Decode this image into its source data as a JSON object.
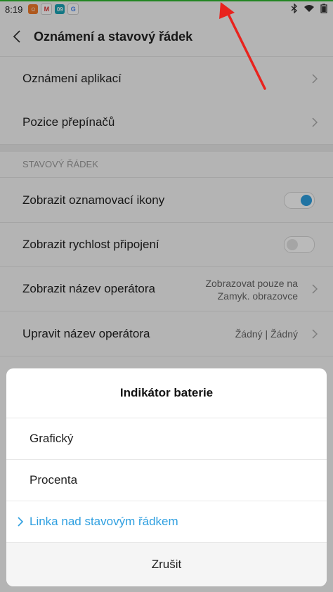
{
  "status_bar": {
    "time": "8:19",
    "app_icons": [
      {
        "name": "notification-app-icon",
        "color": "#f07b2a",
        "glyph": "☺"
      },
      {
        "name": "gmail-icon",
        "color": "#ffffff",
        "glyph": "M"
      },
      {
        "name": "calendar-app-icon",
        "color": "#1aa3b5",
        "glyph": "09"
      },
      {
        "name": "google-icon",
        "color": "#ffffff",
        "glyph": "G"
      }
    ],
    "system_icons": [
      "bluetooth-icon",
      "wifi-icon",
      "battery-icon"
    ]
  },
  "header": {
    "title": "Oznámení a stavový řádek"
  },
  "items": {
    "app_notifications": "Oznámení aplikací",
    "toggle_position": "Pozice přepínačů"
  },
  "section": {
    "title": "STAVOVÝ ŘÁDEK",
    "show_notification_icons": {
      "label": "Zobrazit oznamovací ikony",
      "enabled": true
    },
    "show_connection_speed": {
      "label": "Zobrazit rychlost připojení",
      "enabled": false
    },
    "show_operator_name": {
      "label": "Zobrazit název operátora",
      "value_line1": "Zobrazovat pouze na",
      "value_line2": "Zamyk. obrazovce"
    },
    "edit_operator_name": {
      "label": "Upravit název operátora",
      "value": "Žádný | Žádný"
    }
  },
  "dialog": {
    "title": "Indikátor baterie",
    "options": [
      {
        "label": "Grafický",
        "selected": false
      },
      {
        "label": "Procenta",
        "selected": false
      },
      {
        "label": "Linka nad stavovým řádkem",
        "selected": true
      }
    ],
    "cancel_label": "Zrušit"
  },
  "colors": {
    "accent": "#2e9fe0",
    "battery_line": "#2fb82f",
    "annotation_arrow": "#e8231e"
  }
}
